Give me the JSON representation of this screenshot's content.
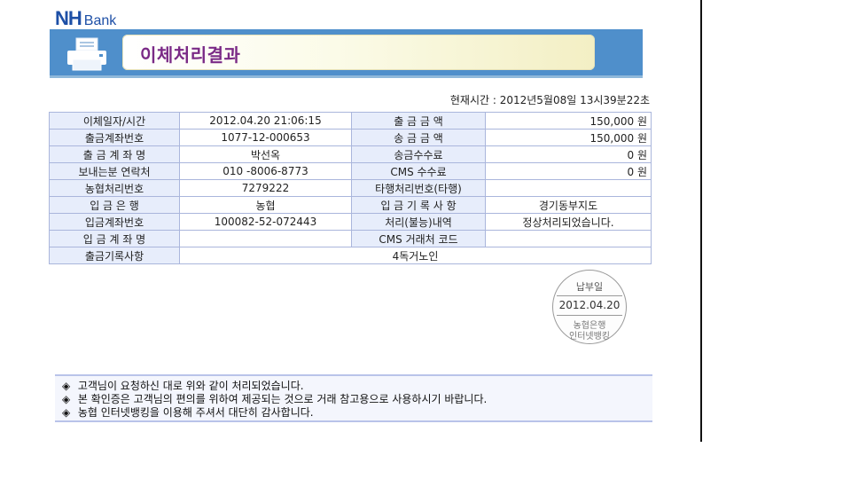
{
  "logo": {
    "brand": "NH",
    "suffix": "Bank"
  },
  "header": {
    "title": "이체처리결과",
    "icon": "printer-icon"
  },
  "current_time": "현재시간 : 2012년5월08일 13시39분22초",
  "rows": [
    {
      "l1": "이체일자/시간",
      "v1": "2012.04.20 21:06:15",
      "l2": "출 금 금 액",
      "v2": "150,000 원"
    },
    {
      "l1": "출금계좌번호",
      "v1": "1077-12-000653",
      "l2": "송 금 금 액",
      "v2": "150,000 원"
    },
    {
      "l1": "출 금 계 좌 명",
      "v1": "박선옥",
      "l2": "송금수수료",
      "v2": "0 원"
    },
    {
      "l1": "보내는분 연락처",
      "v1": "010 -8006-8773",
      "l2": "CMS 수수료",
      "v2": "0 원"
    },
    {
      "l1": "농협처리번호",
      "v1": "7279222",
      "l2": "타행처리번호(타행)",
      "v2": ""
    },
    {
      "l1": "입  금  은  행",
      "v1": "농협",
      "l2": "입 금 기 록 사 항",
      "v2": "경기동부지도"
    },
    {
      "l1": "입금계좌번호",
      "v1": "100082-52-072443",
      "l2": "처리(불능)내역",
      "v2": "정상처리되었습니다."
    },
    {
      "l1": "입 금 계 좌 명",
      "v1": "",
      "l2": "CMS 거래처 코드",
      "v2": ""
    }
  ],
  "memo": {
    "label": "출금기록사항",
    "value": "4독거노인"
  },
  "stamp": {
    "top": "납부일",
    "date": "2012.04.20",
    "bank": "농협은행",
    "service": "인터넷뱅킹"
  },
  "notes": [
    "고객님이 요청하신 대로 위와 같이 처리되었습니다.",
    "본 확인증은 고객님의 편의를 위하여 제공되는 것으로 거래 참고용으로 사용하시기 바랍니다.",
    "농협 인터넷뱅킹을 이용해 주셔서 대단히 감사합니다."
  ],
  "note_mark": "◈",
  "colors": {
    "brand_blue": "#1d4fa6",
    "banner": "#4f8fcb",
    "title": "#7a2a86",
    "label_bg": "#e7edfb",
    "border": "#aab6dc"
  }
}
